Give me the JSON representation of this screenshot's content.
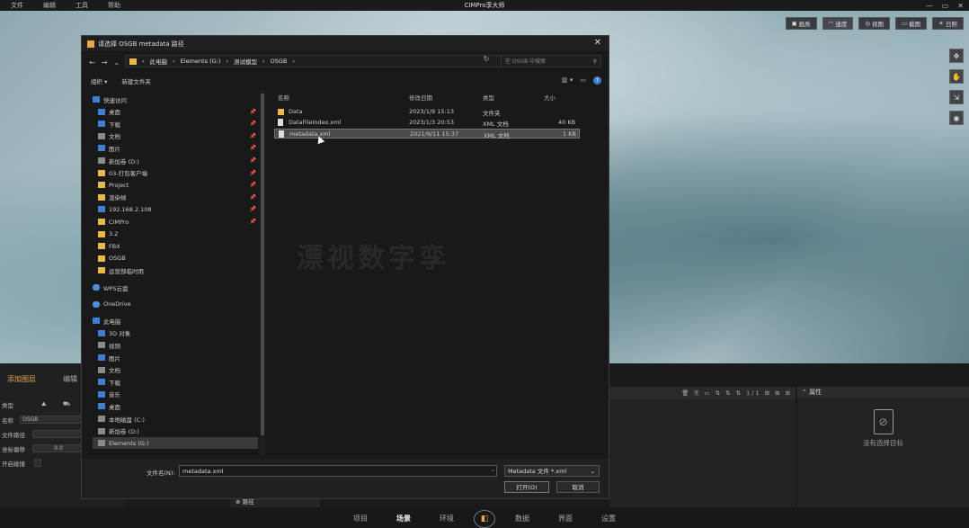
{
  "app": {
    "title": "CIMPro孪大师",
    "menu": [
      "文件",
      "编辑",
      "工具",
      "帮助"
    ],
    "window_controls": [
      "—",
      "▭",
      "✕"
    ]
  },
  "top_buttons": [
    {
      "label": "画质",
      "icon": "image-icon"
    },
    {
      "label": "速度",
      "icon": "speed-icon"
    },
    {
      "label": "视图",
      "icon": "view-icon"
    },
    {
      "label": "截图",
      "icon": "screenshot-icon"
    },
    {
      "label": "日照",
      "icon": "sun-icon"
    }
  ],
  "side_tools": [
    "✥",
    "✋",
    "⇲",
    "◉"
  ],
  "left_panel": {
    "tabs": [
      "添加图层",
      "编辑"
    ],
    "rows": [
      {
        "label": "类型"
      },
      {
        "label": "名称",
        "value": "OSGB"
      },
      {
        "label": "文件路径"
      },
      {
        "label": "坐标偏移",
        "value": "0.0"
      },
      {
        "label": "开启碰撞"
      }
    ],
    "path_btn": "路径"
  },
  "mid_panel": {
    "toolbar": [
      "🗑",
      "⎘",
      "▭",
      "⇅",
      "⇅",
      "⇅",
      "1 / 1",
      "⊞",
      "⊞",
      "⊞"
    ]
  },
  "properties": {
    "header": "属性",
    "empty_text": "没有选择目标"
  },
  "bottom_nav": {
    "items": [
      "项目",
      "场景",
      "环境",
      "数据",
      "界面",
      "设置"
    ],
    "active": "场景"
  },
  "dialog": {
    "title": "请选择 OSGB metadata 路径",
    "close": "✕",
    "breadcrumb": [
      "此电脑",
      "Elements (G:)",
      "测试模型",
      "OSGB"
    ],
    "search_placeholder": "在 OSGB 中搜索",
    "toolbar": {
      "organize": "组织 ▾",
      "new_folder": "新建文件夹"
    },
    "nav_items": [
      {
        "label": "快速访问",
        "icon": "star-icon",
        "level": 0
      },
      {
        "label": "桌面",
        "icon": "desktop-icon",
        "level": 1,
        "pinned": true
      },
      {
        "label": "下载",
        "icon": "download-icon",
        "level": 1,
        "pinned": true
      },
      {
        "label": "文档",
        "icon": "document-icon",
        "level": 1,
        "pinned": true
      },
      {
        "label": "图片",
        "icon": "picture-icon",
        "level": 1,
        "pinned": true
      },
      {
        "label": "新加卷 (D:)",
        "icon": "drive-icon",
        "level": 1,
        "pinned": true
      },
      {
        "label": "03-打包客户端",
        "icon": "folder-icon",
        "level": 1,
        "pinned": true
      },
      {
        "label": "Project",
        "icon": "folder-icon",
        "level": 1,
        "pinned": true
      },
      {
        "label": "渲染帧",
        "icon": "folder-icon",
        "level": 1,
        "pinned": true
      },
      {
        "label": "192.168.2.108",
        "icon": "network-icon",
        "level": 1,
        "pinned": true
      },
      {
        "label": "CIMPro",
        "icon": "folder-icon",
        "level": 1,
        "pinned": true
      },
      {
        "label": "3.2",
        "icon": "folder-icon",
        "level": 1
      },
      {
        "label": "FBX",
        "icon": "folder-icon",
        "level": 1
      },
      {
        "label": "OSGB",
        "icon": "folder-icon",
        "level": 1
      },
      {
        "label": "运营部临时用",
        "icon": "folder-icon",
        "level": 1
      },
      {
        "label": "WPS云盘",
        "icon": "cloud-icon",
        "level": 0
      },
      {
        "label": "OneDrive",
        "icon": "cloud-icon",
        "level": 0
      },
      {
        "label": "此电脑",
        "icon": "computer-icon",
        "level": 0
      },
      {
        "label": "3D 对象",
        "icon": "cube-icon",
        "level": 1
      },
      {
        "label": "视频",
        "icon": "video-icon",
        "level": 1
      },
      {
        "label": "图片",
        "icon": "picture-icon",
        "level": 1
      },
      {
        "label": "文档",
        "icon": "document-icon",
        "level": 1
      },
      {
        "label": "下载",
        "icon": "download-icon",
        "level": 1
      },
      {
        "label": "音乐",
        "icon": "music-icon",
        "level": 1
      },
      {
        "label": "桌面",
        "icon": "desktop-icon",
        "level": 1
      },
      {
        "label": "本地磁盘 (C:)",
        "icon": "drive-icon",
        "level": 1
      },
      {
        "label": "新加卷 (D:)",
        "icon": "drive-icon",
        "level": 1
      },
      {
        "label": "Elements (G:)",
        "icon": "drive-icon",
        "level": 1,
        "selected": true
      }
    ],
    "columns": [
      "名称",
      "修改日期",
      "类型",
      "大小"
    ],
    "files": [
      {
        "name": "Data",
        "date": "2023/1/9 15:13",
        "type": "文件夹",
        "size": "",
        "icon": "folder-icon"
      },
      {
        "name": "DataFileIndex.xml",
        "date": "2023/1/3 20:53",
        "type": "XML 文档",
        "size": "40 KB",
        "icon": "xml-file-icon"
      },
      {
        "name": "metadata.xml",
        "date": "2021/9/11 15:37",
        "type": "XML 文档",
        "size": "1 KB",
        "icon": "xml-file-icon",
        "selected": true
      }
    ],
    "filename_label": "文件名(N):",
    "filename_value": "metadata.xml",
    "filetype_value": "Metadata 文件 *.xml",
    "open_label": "打开(O)",
    "cancel_label": "取消"
  },
  "watermark": "漂视数字孪"
}
